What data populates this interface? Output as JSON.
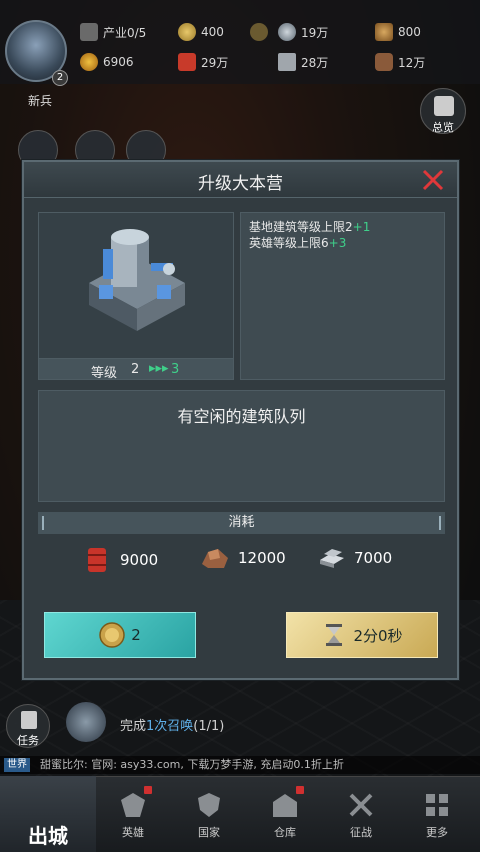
{
  "top_bar": {
    "rank_label": "新兵",
    "avatar_level": "2",
    "industry": "产业0/5",
    "gold_a": "400",
    "coin_b": "19万",
    "medal": "800",
    "power": "6906",
    "oil": "29万",
    "steel": "28万",
    "ore": "12万",
    "overview_label": "总览"
  },
  "dialog": {
    "title": "升级大本营",
    "level_label": "等级",
    "level_current": "2",
    "level_arrow": "▸▸▸",
    "level_next": "3",
    "bonuses": [
      {
        "text": "基地建筑等级上限2",
        "delta": "+1"
      },
      {
        "text": "英雄等级上限6",
        "delta": "+3"
      }
    ],
    "queue_status": "有空闲的建筑队列",
    "cost_title": "消耗",
    "costs": [
      {
        "icon": "oil-barrel-icon",
        "value": "9000"
      },
      {
        "icon": "ore-icon",
        "value": "12000"
      },
      {
        "icon": "steel-icon",
        "value": "7000"
      }
    ],
    "instant_cost": "2",
    "upgrade_time": "2分0秒"
  },
  "bottom": {
    "task_label": "任务",
    "quest_prefix": "完成",
    "quest_highlight": "1次召唤",
    "quest_suffix": "(1/1)",
    "chat_channel": "世界",
    "chat_text": "甜蜜比尔: 官网: asy33.com, 下载万梦手游, 充启动0.1折上折",
    "nav_city": "出城",
    "nav": [
      {
        "label": "英雄"
      },
      {
        "label": "国家"
      },
      {
        "label": "仓库"
      },
      {
        "label": "征战"
      },
      {
        "label": "更多"
      }
    ]
  },
  "colors": {
    "accent_green": "#3fd08a",
    "close_red": "#e0383a",
    "instant_button": "#4cc8c4",
    "upgrade_button": "#e3cd86"
  }
}
